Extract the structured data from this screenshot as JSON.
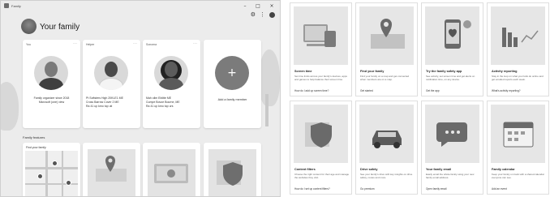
{
  "window": {
    "title": "Family",
    "controls": [
      "minimize",
      "maximize",
      "close"
    ]
  },
  "toolbar": {
    "icons": [
      "settings-icon",
      "more-icon",
      "account-icon"
    ]
  },
  "header": {
    "title": "Your family"
  },
  "members": [
    {
      "role": "You",
      "name": "Family organizer since 2018",
      "detail": "Microsoft (one) view"
    },
    {
      "role": "Helper",
      "line1": "Pt Softsters High 20KLE1 ME",
      "line2": "Cross Barrow Cover 2 ME",
      "line3": "Ra 41 up kmo top uti"
    },
    {
      "role": "Sonoma",
      "line1": "Mah ollm Eblitte ME",
      "line2": "Cumpe Bovoe Bourne, ME",
      "line3": "Ra 41 up kmo top urs"
    },
    {
      "role": "",
      "add_label": "Add a family member"
    }
  ],
  "features": {
    "heading": "Family features",
    "cards": [
      {
        "label": "Find your family"
      },
      {
        "label": ""
      },
      {
        "label": ""
      },
      {
        "label": ""
      }
    ]
  },
  "tiles_top": [
    {
      "title": "Screen time",
      "desc": "Set time limits across your family's devices, apps and games to help balance their screen time.",
      "link": "How do I add up screen time?"
    },
    {
      "title": "Find your family",
      "desc": "Find your family on a map and get connected when members are on a map.",
      "link": "Get started"
    },
    {
      "title": "Try the family safety app",
      "desc": "See activity, set screen time and get alerts on notification time, on any device.",
      "link": "Get the app"
    },
    {
      "title": "Activity reporting",
      "desc": "Stay in the loop on what your kids do online and get emailed reports each week.",
      "link": "What's activity reporting?"
    }
  ],
  "tiles_bottom": [
    {
      "title": "Content filters",
      "desc": "Choose the right content for their age and manage the websites they visit.",
      "link": "How do I set up content filters?"
    },
    {
      "title": "Drive safety",
      "desc": "See your family's drive with key insights on drive safety, routes and more.",
      "link": "Go premium"
    },
    {
      "title": "Your family email",
      "desc": "Easily email the whole family using your new family email address.",
      "link": "Open family email"
    },
    {
      "title": "Family calendar",
      "desc": "Keep your family on track with a shared calendar everyone can see.",
      "link": "Add an event"
    }
  ]
}
